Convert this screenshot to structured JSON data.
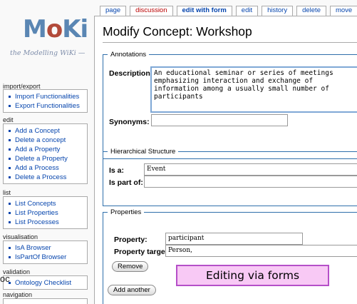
{
  "logo": {
    "wordmark_m": "M",
    "wordmark_o": "o",
    "wordmark_ki": "Ki",
    "tagline": "the Modelling WiKi —"
  },
  "sidebar": {
    "import_export": {
      "title": "import/export",
      "items": [
        "Import Functionalities",
        "Export Functionalities"
      ]
    },
    "edit": {
      "title": "edit",
      "items": [
        "Add a Concept",
        "Delete a concept",
        "Add a Property",
        "Delete a Property",
        "Add a Process",
        "Delete a Process"
      ]
    },
    "list": {
      "title": "list",
      "items": [
        "List Concepts",
        "List Properties",
        "List Processes"
      ]
    },
    "visualisation": {
      "title": "visualisation",
      "items": [
        "IsA Browser",
        "IsPartOf Browser"
      ]
    },
    "validation": {
      "title": "validation",
      "items": [
        "Ontology Checklist"
      ]
    },
    "navigation": {
      "title": "navigation"
    }
  },
  "tabs": [
    "page",
    "discussion",
    "edit with form",
    "edit",
    "history",
    "delete",
    "move"
  ],
  "page": {
    "title": "Modify Concept: Workshop"
  },
  "annotations": {
    "legend": "Annotations",
    "description_label": "Description:",
    "description_value": "An educational seminar or series of meetings\nemphasizing interaction and exchange of\ninformation among a usually small number of\nparticipants",
    "synonyms_label": "Synonyms:",
    "synonyms_value": ""
  },
  "hierarchy": {
    "legend": "Hierarchical Structure",
    "is_a_label": "Is a:",
    "is_a_value": "Event",
    "part_of_label": "Is part of:",
    "part_of_value": ""
  },
  "properties": {
    "legend": "Properties",
    "property_label": "Property:",
    "property_value": "participant",
    "target_label": "Property target:",
    "target_value": "Person,",
    "remove_button": "Remove",
    "add_button": "Add another"
  },
  "banner": {
    "text": "Editing via forms"
  },
  "left_fragment": {
    "text": "oc"
  },
  "colors": {
    "link": "#0645ad",
    "current_tab": "#ba0000",
    "fieldset_border": "#2f6fab",
    "banner_fill": "#f8c9f5",
    "banner_border": "#b54fc8"
  }
}
